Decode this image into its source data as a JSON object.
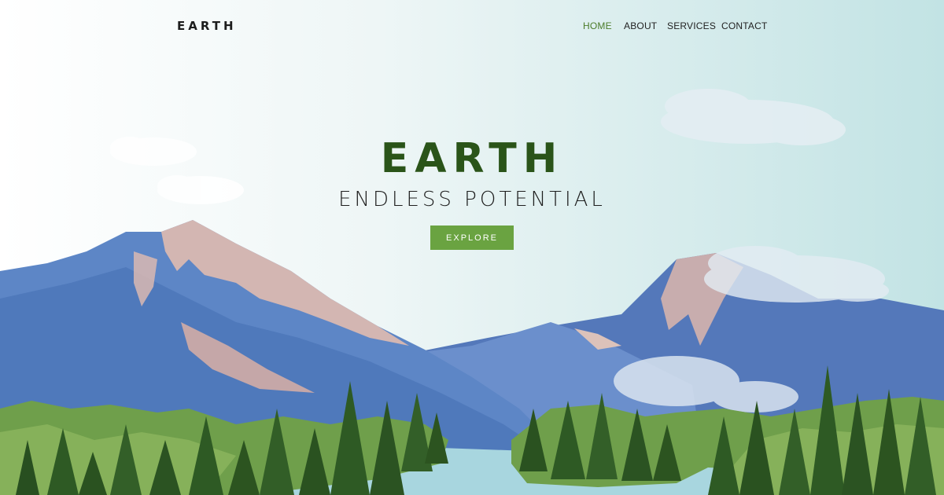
{
  "brand": {
    "logo": "EARTH"
  },
  "nav": {
    "items": [
      {
        "label": "HOME",
        "active": true
      },
      {
        "label": "ABOUT",
        "active": false
      },
      {
        "label": "SERVICES",
        "active": false
      },
      {
        "label": "CONTACT",
        "active": false
      }
    ]
  },
  "hero": {
    "title": "EARTH",
    "subtitle": "ENDLESS POTENTIAL",
    "cta_label": "EXPLORE"
  },
  "colors": {
    "accent_green": "#6aa341",
    "title_green": "#2a5419",
    "active_nav": "#4c7c2b",
    "mountain_blue": "#5a85c4",
    "water": "#a8d6df"
  }
}
